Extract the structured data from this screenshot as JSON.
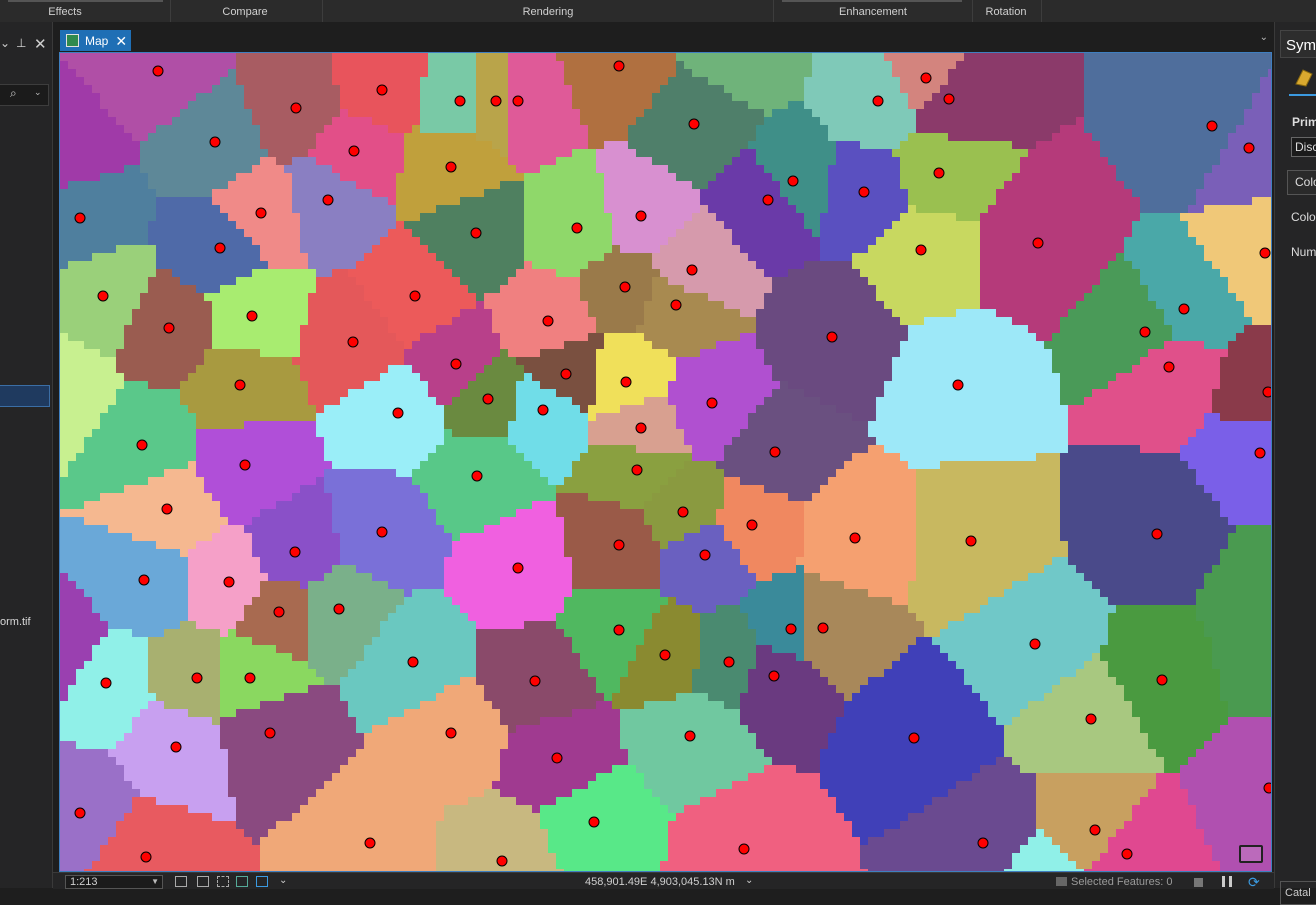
{
  "ribbon": {
    "groups": [
      {
        "label": "Effects"
      },
      {
        "label": "Compare"
      },
      {
        "label": "Rendering"
      },
      {
        "label": "Enhancement"
      },
      {
        "label": "Rotation"
      }
    ]
  },
  "left_pane": {
    "layer_name_fragment": "orm.tif"
  },
  "map_view": {
    "tab_label": "Map",
    "scale": "1:213",
    "coordinates": "458,901.49E 4,903,045.13N m",
    "selected_features": "Selected Features: 0"
  },
  "symbology_pane": {
    "title": "Sym",
    "primary_label": "Prim",
    "primary_value": "Disc",
    "color_tab": "Colo",
    "color_scheme_label": "Colo",
    "number_label": "Num",
    "bottom_tab": "Catal"
  },
  "colors": {
    "accent": "#1f6fb5",
    "point_fill": "#ff0000",
    "point_stroke": "#000000",
    "background": "#1e1e1e"
  },
  "icons": [
    "pin-icon",
    "close-icon",
    "search-icon",
    "map-tab-icon",
    "chevron-down-icon",
    "symbology-icon",
    "pause-icon",
    "refresh-icon"
  ]
}
